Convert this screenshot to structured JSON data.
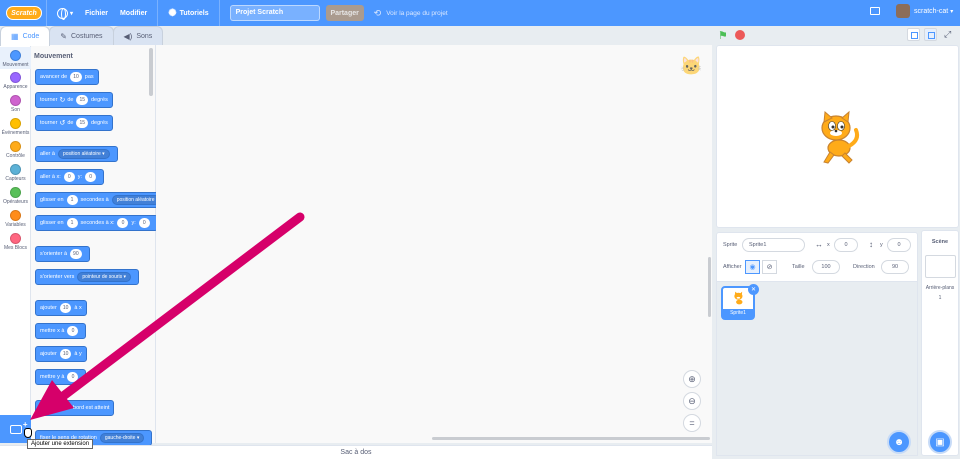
{
  "menubar": {
    "logo": "Scratch",
    "file": "Fichier",
    "edit": "Modifier",
    "tutorials": "Tutoriels",
    "project_title": "Projet Scratch",
    "share": "Partager",
    "see_project_page": "Voir la page du projet",
    "username": "scratch-cat"
  },
  "tabs": [
    {
      "label": "Code",
      "icon": "code-icon"
    },
    {
      "label": "Costumes",
      "icon": "brush-icon"
    },
    {
      "label": "Sons",
      "icon": "speaker-icon"
    }
  ],
  "categories": [
    {
      "label": "Mouvement",
      "color": "#4c97ff"
    },
    {
      "label": "Apparence",
      "color": "#9966ff"
    },
    {
      "label": "Son",
      "color": "#cf63cf"
    },
    {
      "label": "Événements",
      "color": "#ffbf00"
    },
    {
      "label": "Contrôle",
      "color": "#ffab19"
    },
    {
      "label": "Capteurs",
      "color": "#5cb1d6"
    },
    {
      "label": "Opérateurs",
      "color": "#59c059"
    },
    {
      "label": "Variables",
      "color": "#ff8c1a"
    },
    {
      "label": "Mes Blocs",
      "color": "#ff6680"
    }
  ],
  "palette": {
    "title": "Mouvement",
    "blocks": {
      "move": {
        "pre": "avancer de",
        "v": "10",
        "post": "pas"
      },
      "turn_right": {
        "pre": "tourner",
        "mid": "de",
        "v": "15",
        "post": "degrés"
      },
      "turn_left": {
        "pre": "tourner",
        "mid": "de",
        "v": "15",
        "post": "degrés"
      },
      "goto": {
        "pre": "aller à",
        "dd": "position aléatoire"
      },
      "goto_xy": {
        "pre": "aller à x:",
        "x": "0",
        "y_label": "y:",
        "y": "0"
      },
      "glide": {
        "pre": "glisser en",
        "v": "1",
        "mid": "secondes à",
        "dd": "position aléatoire"
      },
      "glide_xy": {
        "pre": "glisser en",
        "v": "1",
        "mid": "secondes à x:",
        "x": "0",
        "y_label": "y:",
        "y": "0"
      },
      "point_dir": {
        "pre": "s'orienter à",
        "v": "90"
      },
      "point_to": {
        "pre": "s'orienter vers",
        "dd": "pointeur de souris"
      },
      "change_x": {
        "pre": "ajouter",
        "v": "10",
        "post": "à x"
      },
      "set_x": {
        "pre": "mettre x à",
        "v": "0"
      },
      "change_y": {
        "pre": "ajouter",
        "v": "10",
        "post": "à y"
      },
      "set_y": {
        "pre": "mettre y à",
        "v": "0"
      },
      "bounce": {
        "text": "rebondir si le bord est atteint"
      },
      "rotation": {
        "pre": "fixer le sens de rotation",
        "dd": "gauche-droite"
      }
    }
  },
  "extension_tooltip": "Ajouter une extension",
  "backpack_label": "Sac à dos",
  "sprite_info": {
    "sprite_label": "Sprite",
    "sprite_name": "Sprite1",
    "x_label": "x",
    "x_value": "0",
    "y_label": "y",
    "y_value": "0",
    "show_label": "Afficher",
    "size_label": "Taille",
    "size_value": "100",
    "direction_label": "Direction",
    "direction_value": "90"
  },
  "sprites": [
    {
      "name": "Sprite1",
      "selected": true
    }
  ],
  "stage_panel": {
    "title": "Scène",
    "backdrops_label": "Arrière-plans",
    "backdrops_count": "1"
  },
  "colors": {
    "accent": "#4c97ff",
    "motion": "#4c97ff",
    "annotation_arrow": "#d6006a",
    "flag": "#4cbf56",
    "stop": "#ec5959"
  }
}
